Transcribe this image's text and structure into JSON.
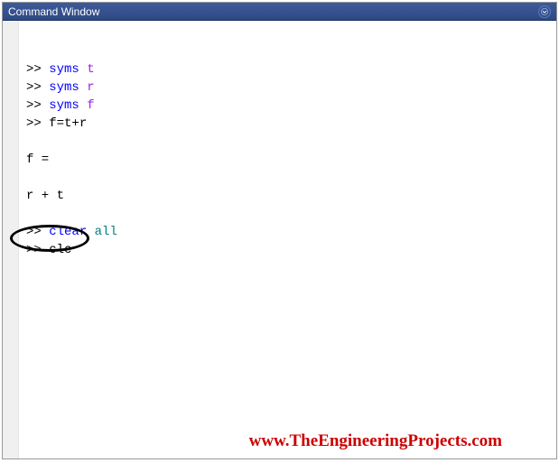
{
  "titlebar": {
    "title": "Command Window"
  },
  "code": {
    "lines": [
      {
        "prompt": ">> ",
        "parts": [
          {
            "cls": "kw-blue",
            "text": "syms "
          },
          {
            "cls": "kw-purple",
            "text": "t"
          }
        ]
      },
      {
        "prompt": ">> ",
        "parts": [
          {
            "cls": "kw-blue",
            "text": "syms "
          },
          {
            "cls": "kw-purple",
            "text": "r"
          }
        ]
      },
      {
        "prompt": ">> ",
        "parts": [
          {
            "cls": "kw-blue",
            "text": "syms "
          },
          {
            "cls": "kw-purple",
            "text": "f"
          }
        ]
      },
      {
        "prompt": ">> ",
        "parts": [
          {
            "cls": "cmd",
            "text": "f=t+r"
          }
        ]
      },
      {
        "prompt": "",
        "parts": [
          {
            "cls": "cmd",
            "text": " "
          }
        ]
      },
      {
        "prompt": "",
        "parts": [
          {
            "cls": "cmd",
            "text": "f ="
          }
        ]
      },
      {
        "prompt": "",
        "parts": [
          {
            "cls": "cmd",
            "text": " "
          }
        ]
      },
      {
        "prompt": "",
        "parts": [
          {
            "cls": "cmd",
            "text": "r + t"
          }
        ]
      },
      {
        "prompt": "",
        "parts": [
          {
            "cls": "cmd",
            "text": " "
          }
        ]
      },
      {
        "prompt": ">> ",
        "parts": [
          {
            "cls": "kw-blue",
            "text": "clear "
          },
          {
            "cls": "kw-teal",
            "text": "all"
          }
        ]
      },
      {
        "prompt": ">> ",
        "parts": [
          {
            "cls": "cmd",
            "text": "clc"
          }
        ]
      }
    ]
  },
  "watermark": {
    "text": "www.TheEngineeringProjects.com"
  }
}
